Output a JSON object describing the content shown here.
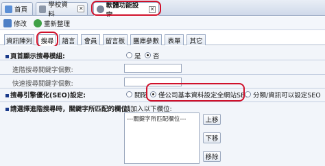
{
  "top_tabs": [
    {
      "label": "首頁",
      "icon": "home-icon"
    },
    {
      "label": "學校資料",
      "icon": "school-icon"
    },
    {
      "label": "軟體功能設定",
      "icon": "gear-icon"
    }
  ],
  "toolbar": {
    "edit_label": "修改",
    "refresh_label": "重新整理"
  },
  "sub_tabs": [
    "資訊陣列",
    "搜尋",
    "語言",
    "會員",
    "留言板",
    "團庫參數",
    "表單",
    "其它"
  ],
  "form": {
    "row1": {
      "label": "頁首顯示搜尋模組:",
      "option_yes": "是",
      "option_no": "否",
      "selected": "否"
    },
    "row2": {
      "label": "進階搜尋關鍵字個數:"
    },
    "row3": {
      "label": "快速搜尋關鍵字個數:"
    },
    "row4": {
      "label": "搜尋引擎優化(SEO)設定:",
      "options": [
        "關閉",
        "僅公司基本資料設定全網站SEO",
        "分類/資訊可以設定SEO"
      ],
      "selected": "僅公司基本資料設定全網站SEO"
    },
    "row5": {
      "label": "請選擇進階搜尋時，關鍵字所匹配的欄位:",
      "hint": "請加入以下欄位:",
      "list_item": "---關鍵字所匹配欄位---",
      "up_button": "上移",
      "down_button": "下移",
      "remove_button": "移除"
    }
  },
  "colors": {
    "highlight": "#d0102a",
    "accent": "#1a3a8a"
  }
}
